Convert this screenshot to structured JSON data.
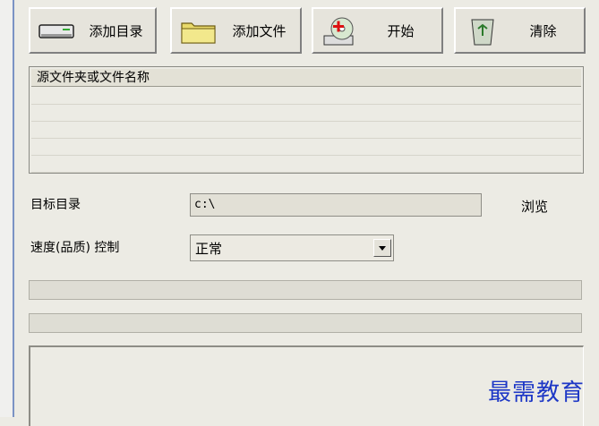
{
  "toolbar": {
    "add_folder_label": "添加目录",
    "add_file_label": "添加文件",
    "start_label": "开始",
    "clear_label": "清除"
  },
  "list": {
    "header": "源文件夹或文件名称"
  },
  "target": {
    "label": "目标目录",
    "value": "c:\\",
    "browse_label": "浏览"
  },
  "speed": {
    "label": "速度(品质) 控制",
    "value": "正常"
  },
  "watermark": "最需教育",
  "icons": [
    "drive-icon",
    "folder-icon",
    "cd-add-icon",
    "recycle-bin-icon"
  ]
}
